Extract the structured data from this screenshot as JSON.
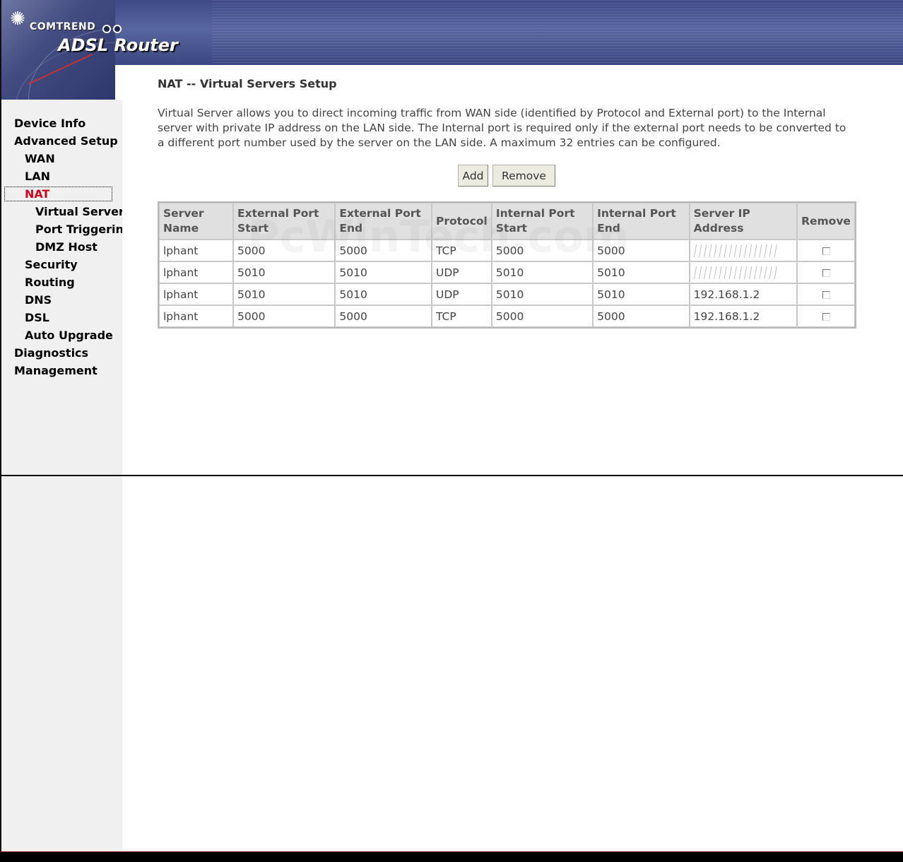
{
  "header": {
    "brand": "COMTREND",
    "product": "ADSL Router"
  },
  "sidebar": {
    "items": [
      {
        "label": "Device Info",
        "level": 1,
        "active": false
      },
      {
        "label": "Advanced Setup",
        "level": 1,
        "active": false
      },
      {
        "label": "WAN",
        "level": 2,
        "active": false
      },
      {
        "label": "LAN",
        "level": 2,
        "active": false
      },
      {
        "label": "NAT",
        "level": 2,
        "active": true
      },
      {
        "label": "Virtual Servers",
        "level": 3,
        "active": false
      },
      {
        "label": "Port Triggering",
        "level": 3,
        "active": false
      },
      {
        "label": "DMZ Host",
        "level": 3,
        "active": false
      },
      {
        "label": "Security",
        "level": 2,
        "active": false
      },
      {
        "label": "Routing",
        "level": 2,
        "active": false
      },
      {
        "label": "DNS",
        "level": 2,
        "active": false
      },
      {
        "label": "DSL",
        "level": 2,
        "active": false
      },
      {
        "label": "Auto Upgrade",
        "level": 2,
        "active": false
      },
      {
        "label": "Diagnostics",
        "level": 1,
        "active": false
      },
      {
        "label": "Management",
        "level": 1,
        "active": false
      }
    ],
    "active_color": "#d0001a"
  },
  "main": {
    "title": "NAT -- Virtual Servers Setup",
    "description": "Virtual Server allows you to direct incoming traffic from WAN side (identified by Protocol and External port) to the Internal server with private IP address on the LAN side. The Internal port is required only if the external port needs to be converted to a different port number used by the server on the LAN side. A maximum 32 entries can be configured.",
    "add_label": "Add",
    "remove_label": "Remove",
    "watermark": "PcWinTech.com"
  },
  "table": {
    "headers": [
      [
        "Server",
        "Name"
      ],
      [
        "External Port",
        "Start"
      ],
      [
        "External Port",
        "End"
      ],
      [
        "Protocol"
      ],
      [
        "Internal Port",
        "Start"
      ],
      [
        "Internal Port",
        "End"
      ],
      [
        "Server IP",
        "Address"
      ],
      [
        "Remove"
      ]
    ],
    "rows": [
      {
        "name": "lphant",
        "ext_start": "5000",
        "ext_end": "5000",
        "protocol": "TCP",
        "int_start": "5000",
        "int_end": "5000",
        "ip": "",
        "ip_redacted": true
      },
      {
        "name": "lphant",
        "ext_start": "5010",
        "ext_end": "5010",
        "protocol": "UDP",
        "int_start": "5010",
        "int_end": "5010",
        "ip": "",
        "ip_redacted": true
      },
      {
        "name": "lphant",
        "ext_start": "5010",
        "ext_end": "5010",
        "protocol": "UDP",
        "int_start": "5010",
        "int_end": "5010",
        "ip": "192.168.1.2",
        "ip_redacted": false
      },
      {
        "name": "lphant",
        "ext_start": "5000",
        "ext_end": "5000",
        "protocol": "TCP",
        "int_start": "5000",
        "int_end": "5000",
        "ip": "192.168.1.2",
        "ip_redacted": false
      }
    ]
  }
}
